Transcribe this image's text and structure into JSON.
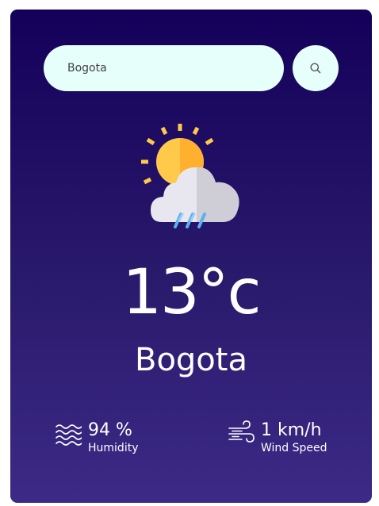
{
  "search": {
    "value": "Bogota",
    "placeholder": ""
  },
  "weather": {
    "icon": "sun-cloud-rain-icon",
    "temperature": "13°c",
    "city": "Bogota"
  },
  "stats": {
    "humidity": {
      "value": "94 %",
      "label": "Humidity",
      "icon": "waves-icon"
    },
    "wind": {
      "value": "1 km/h",
      "label": "Wind Speed",
      "icon": "wind-icon"
    }
  },
  "colors": {
    "card_top": "#14005a",
    "card_bottom": "#3c2a86",
    "input_bg": "#e6fffb",
    "sun": "#ffc94a",
    "sun_shade": "#ffb02e",
    "cloud": "#e8e6ee",
    "cloud_shade": "#cfcdd6",
    "rain": "#5ab0f0"
  }
}
